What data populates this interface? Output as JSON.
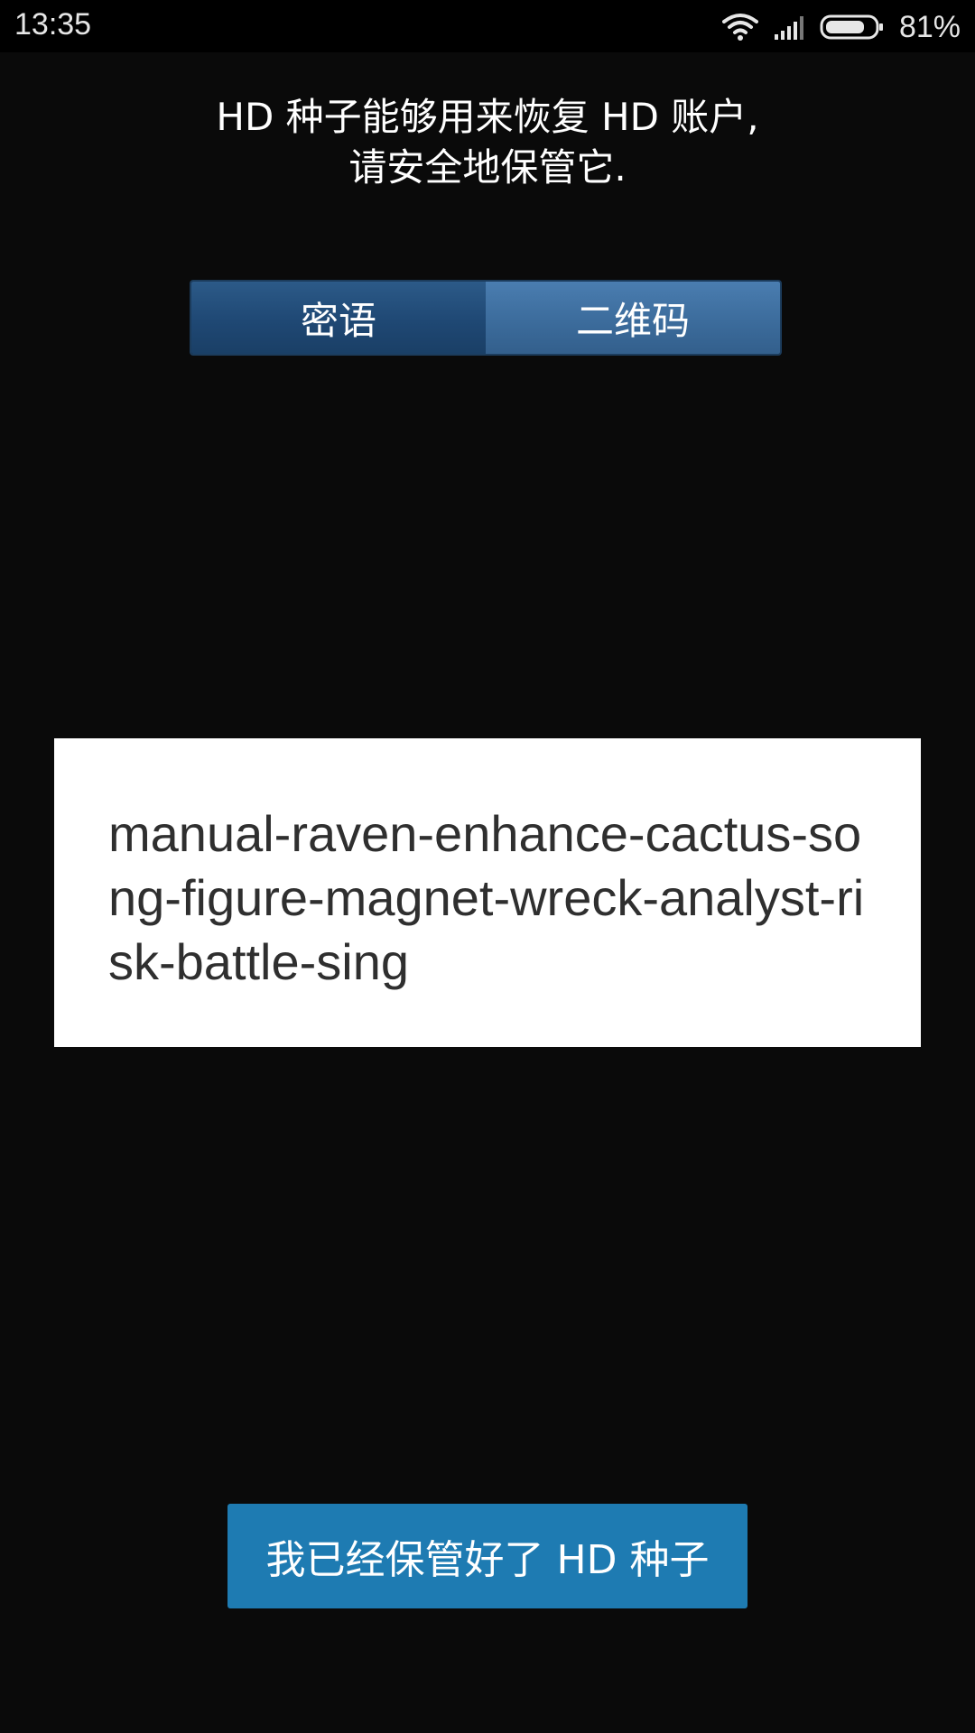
{
  "status_bar": {
    "time": "13:35",
    "battery_percent": "81%",
    "battery_level": 0.81,
    "icons": [
      "wifi-icon",
      "signal-icon",
      "battery-icon"
    ]
  },
  "header": {
    "line1": "HD 种子能够用来恢复 HD 账户,",
    "line2": "请安全地保管它."
  },
  "tabs": {
    "items": [
      {
        "label": "密语",
        "active": true
      },
      {
        "label": "二维码",
        "active": false
      }
    ]
  },
  "phrase": {
    "text": "manual-raven-enhance-cactus-song-figure-magnet-wreck-analyst-risk-battle-sing"
  },
  "actions": {
    "confirm_label": "我已经保管好了 HD 种子"
  },
  "colors": {
    "background": "#0a0a0a",
    "tab_active": "#1f4874",
    "tab_inactive": "#3c6c9c",
    "button": "#1e7bb2"
  }
}
